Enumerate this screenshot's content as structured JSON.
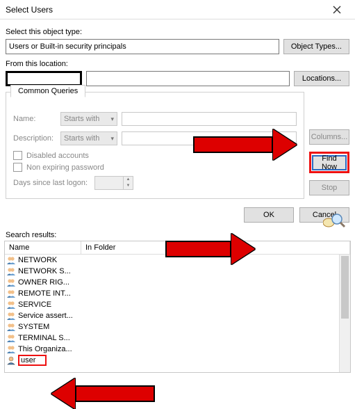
{
  "title": "Select Users",
  "labels": {
    "object_type": "Select this object type:",
    "from_location": "From this location:",
    "common_queries": "Common Queries",
    "name": "Name:",
    "description": "Description:",
    "disabled": "Disabled accounts",
    "nonexpire": "Non expiring password",
    "days_since": "Days since last logon:",
    "search_results": "Search results:"
  },
  "fields": {
    "object_type_value": "Users or Built-in security principals",
    "location_value": "",
    "name_value": "",
    "desc_value": ""
  },
  "combos": {
    "starts_with": "Starts with"
  },
  "buttons": {
    "object_types": "Object Types...",
    "locations": "Locations...",
    "columns": "Columns...",
    "find_now": "Find Now",
    "stop": "Stop",
    "ok": "OK",
    "cancel": "Cancel"
  },
  "results": {
    "columns": {
      "name": "Name",
      "in_folder": "In Folder"
    },
    "rows": [
      {
        "icon": "group",
        "name": "NETWORK"
      },
      {
        "icon": "group",
        "name": "NETWORK S..."
      },
      {
        "icon": "group",
        "name": "OWNER RIG..."
      },
      {
        "icon": "group",
        "name": "REMOTE INT..."
      },
      {
        "icon": "group",
        "name": "SERVICE"
      },
      {
        "icon": "group",
        "name": "Service assert..."
      },
      {
        "icon": "group",
        "name": "SYSTEM"
      },
      {
        "icon": "group",
        "name": "TERMINAL S..."
      },
      {
        "icon": "group",
        "name": "This Organiza..."
      },
      {
        "icon": "user",
        "name": "user",
        "selected": true
      }
    ]
  }
}
